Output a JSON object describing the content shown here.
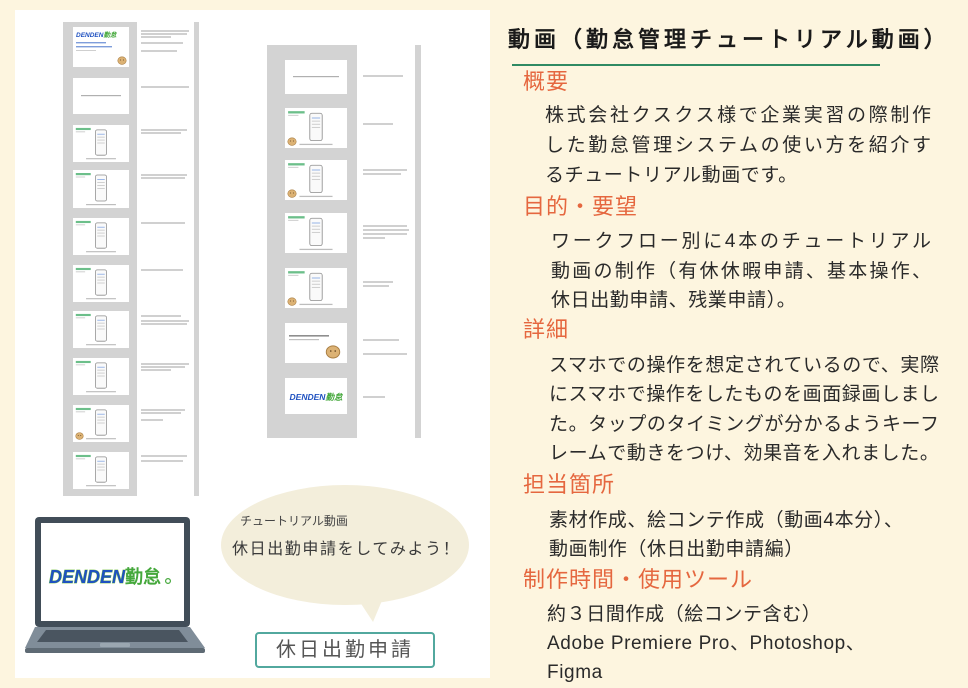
{
  "logo": {
    "latin": "DENDEN",
    "kanji": "勤怠"
  },
  "bubble": {
    "caption": "チュートリアル動画",
    "message": "休日出勤申請をしてみよう！"
  },
  "badge": {
    "label": "休日出勤申請"
  },
  "article": {
    "title": "動画（勤怠管理チュートリアル動画）",
    "sections": [
      {
        "heading": "概要",
        "lines": [
          "株式会社クスクス様で企業実習の際制作",
          "した勤怠管理システムの使い方を紹介す",
          "るチュートリアル動画です。"
        ]
      },
      {
        "heading": "目的・要望",
        "lines": [
          "ワークフロー別に4本のチュートリアル",
          "動画の制作（有休休暇申請、基本操作、",
          "休日出勤申請、残業申請）。"
        ]
      },
      {
        "heading": "詳細",
        "lines": [
          "スマホでの操作を想定されているので、実際",
          "にスマホで操作をしたものを画面録画しまし",
          "た。タップのタイミングが分かるようキーフ",
          "レームで動きをつけ、効果音を入れました。"
        ]
      },
      {
        "heading": "担当箇所",
        "lines": [
          "素材作成、絵コンテ作成（動画4本分）、",
          "動画制作（休日出勤申請編）"
        ]
      },
      {
        "heading": "制作時間・使用ツール",
        "lines": [
          "約３日間作成（絵コンテ含む）",
          "Adobe Premiere Pro、Photoshop、",
          "Figma"
        ]
      }
    ]
  },
  "colors": {
    "background": "#fdf5df",
    "heading": "#e5673f",
    "title_rule": "#2f8a63",
    "badge_border": "#52a89e",
    "logo_blue": "#1f51c0",
    "logo_green": "#45a83c"
  }
}
